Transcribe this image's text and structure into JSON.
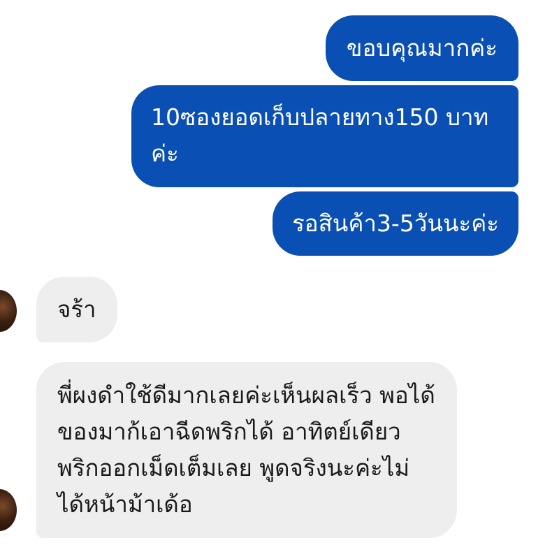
{
  "messages": {
    "outgoing": [
      {
        "text": "ขอบคุณมากค่ะ"
      },
      {
        "text": "10ซองยอดเก็บปลายทาง150 บาทค่ะ"
      },
      {
        "text": "รอสินค้า3-5วันนะค่ะ"
      }
    ],
    "incoming": [
      {
        "text": "จร้า"
      },
      {
        "text": "พี่ผงดำใช้ดีมากเลยค่ะเห็นผลเร็ว พอได้ของมาก้เอาฉีดพริกได้ อาทิตย์เดียวพริกออกเม็ดเต็มเลย พูดจริงนะค่ะไม่ได้หน้าม้าเด้อ"
      }
    ]
  },
  "colors": {
    "outgoing_bubble": "#0a4fb3",
    "incoming_bubble": "#eeeeef"
  },
  "icons": {
    "avatar": "sender-avatar"
  }
}
